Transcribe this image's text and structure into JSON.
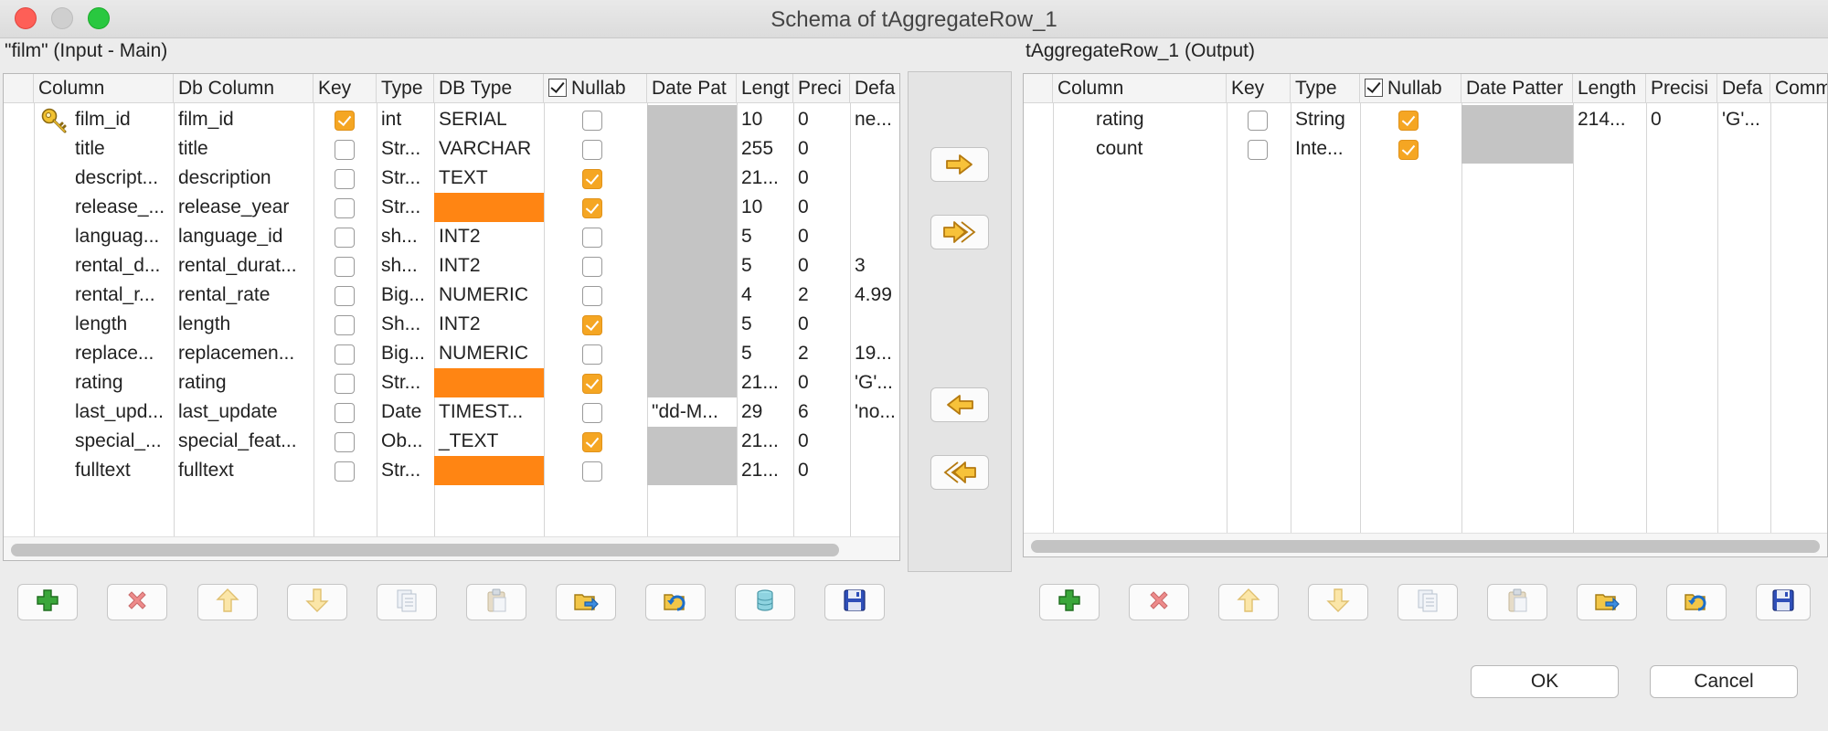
{
  "window": {
    "title": "Schema of tAggregateRow_1"
  },
  "input": {
    "label": "\"film\" (Input - Main)",
    "headers": [
      "Column",
      "Db Column",
      "Key",
      "Type",
      "DB Type",
      "Nullab",
      "Date Pat",
      "Lengt",
      "Preci",
      "Defa"
    ],
    "rows": [
      {
        "column": "film_id",
        "db_column": "film_id",
        "key": true,
        "type": "int",
        "db_type": "SERIAL",
        "db_type_missing": false,
        "nullable": false,
        "date_pattern": "",
        "length": "10",
        "precision": "0",
        "default": "ne...",
        "key_icon": "key-icon"
      },
      {
        "column": "title",
        "db_column": "title",
        "key": false,
        "type": "Str...",
        "db_type": "VARCHAR",
        "db_type_missing": false,
        "nullable": false,
        "date_pattern": "",
        "length": "255",
        "precision": "0",
        "default": ""
      },
      {
        "column": "descript...",
        "db_column": "description",
        "key": false,
        "type": "Str...",
        "db_type": "TEXT",
        "db_type_missing": false,
        "nullable": true,
        "date_pattern": "",
        "length": "21...",
        "precision": "0",
        "default": ""
      },
      {
        "column": "release_...",
        "db_column": "release_year",
        "key": false,
        "type": "Str...",
        "db_type": "",
        "db_type_missing": true,
        "nullable": true,
        "date_pattern": "",
        "length": "10",
        "precision": "0",
        "default": ""
      },
      {
        "column": "languag...",
        "db_column": "language_id",
        "key": false,
        "type": "sh...",
        "db_type": "INT2",
        "db_type_missing": false,
        "nullable": false,
        "date_pattern": "",
        "length": "5",
        "precision": "0",
        "default": ""
      },
      {
        "column": "rental_d...",
        "db_column": "rental_durat...",
        "key": false,
        "type": "sh...",
        "db_type": "INT2",
        "db_type_missing": false,
        "nullable": false,
        "date_pattern": "",
        "length": "5",
        "precision": "0",
        "default": "3"
      },
      {
        "column": "rental_r...",
        "db_column": "rental_rate",
        "key": false,
        "type": "Big...",
        "db_type": "NUMERIC",
        "db_type_missing": false,
        "nullable": false,
        "date_pattern": "",
        "length": "4",
        "precision": "2",
        "default": "4.99"
      },
      {
        "column": "length",
        "db_column": "length",
        "key": false,
        "type": "Sh...",
        "db_type": "INT2",
        "db_type_missing": false,
        "nullable": true,
        "date_pattern": "",
        "length": "5",
        "precision": "0",
        "default": ""
      },
      {
        "column": "replace...",
        "db_column": "replacemen...",
        "key": false,
        "type": "Big...",
        "db_type": "NUMERIC",
        "db_type_missing": false,
        "nullable": false,
        "date_pattern": "",
        "length": "5",
        "precision": "2",
        "default": "19..."
      },
      {
        "column": "rating",
        "db_column": "rating",
        "key": false,
        "type": "Str...",
        "db_type": "",
        "db_type_missing": true,
        "nullable": true,
        "date_pattern": "",
        "length": "21...",
        "precision": "0",
        "default": "'G'..."
      },
      {
        "column": "last_upd...",
        "db_column": "last_update",
        "key": false,
        "type": "Date",
        "db_type": "TIMEST...",
        "db_type_missing": false,
        "nullable": false,
        "date_pattern": "\"dd-M...",
        "length": "29",
        "precision": "6",
        "default": "'no..."
      },
      {
        "column": "special_...",
        "db_column": "special_feat...",
        "key": false,
        "type": "Ob...",
        "db_type": "_TEXT",
        "db_type_missing": false,
        "nullable": true,
        "date_pattern": "",
        "length": "21...",
        "precision": "0",
        "default": ""
      },
      {
        "column": "fulltext",
        "db_column": "fulltext",
        "key": false,
        "type": "Str...",
        "db_type": "",
        "db_type_missing": true,
        "nullable": false,
        "date_pattern": "",
        "length": "21...",
        "precision": "0",
        "default": ""
      }
    ]
  },
  "output": {
    "label": "tAggregateRow_1 (Output)",
    "headers": [
      "Column",
      "Key",
      "Type",
      "Nullab",
      "Date Patter",
      "Length",
      "Precisi",
      "Defa",
      "Comm"
    ],
    "rows": [
      {
        "column": "rating",
        "key": false,
        "type": "String",
        "nullable": true,
        "date_pattern": "",
        "length": "214...",
        "precision": "0",
        "default": "'G'..."
      },
      {
        "column": "count",
        "key": false,
        "type": "Inte...",
        "nullable": true,
        "date_pattern": "",
        "length": "",
        "precision": "",
        "default": ""
      }
    ]
  },
  "transfer_buttons": [
    "copy-selected-right-icon",
    "copy-all-right-icon",
    "copy-selected-left-icon",
    "copy-all-left-icon"
  ],
  "toolbar_icons": [
    "add-icon",
    "remove-icon",
    "move-up-icon",
    "move-down-icon",
    "copy-icon",
    "paste-icon",
    "import-icon",
    "export-icon",
    "reset-db-types-icon",
    "save-icon"
  ],
  "buttons": {
    "ok": "OK",
    "cancel": "Cancel"
  },
  "colors": {
    "missing_db_type": "#ff8513",
    "checked": "#f5a623",
    "date_pattern_disabled": "#c4c4c4"
  }
}
